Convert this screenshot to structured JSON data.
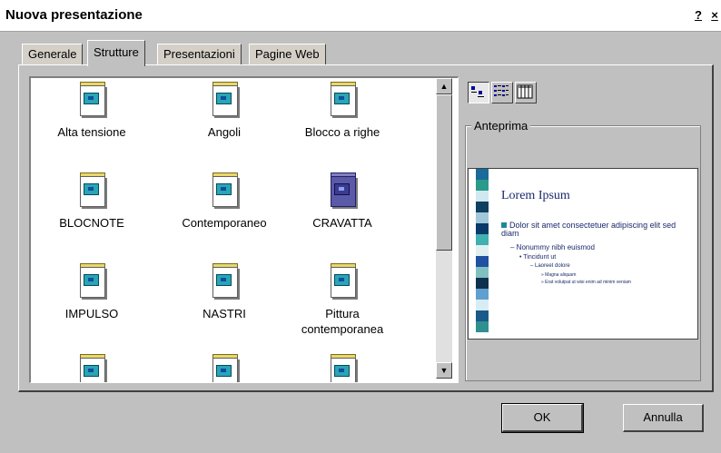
{
  "window": {
    "title": "Nuova presentazione",
    "help_glyph": "?",
    "close_glyph": "×"
  },
  "tabs": [
    {
      "label": "Generale",
      "active": false
    },
    {
      "label": "Strutture",
      "active": true
    },
    {
      "label": "Presentazioni",
      "active": false
    },
    {
      "label": "Pagine Web",
      "active": false
    }
  ],
  "templates": [
    {
      "label": "Alta tensione"
    },
    {
      "label": "Angoli"
    },
    {
      "label": "Blocco a righe"
    },
    {
      "label": "BLOCNOTE"
    },
    {
      "label": "Contemporaneo"
    },
    {
      "label": "CRAVATTA",
      "selected": true
    },
    {
      "label": "IMPULSO"
    },
    {
      "label": "NASTRI"
    },
    {
      "label": "Pittura contemporanea"
    },
    {
      "label": ""
    },
    {
      "label": ""
    },
    {
      "label": ""
    }
  ],
  "view_buttons": [
    {
      "icon": "large-icons-view-icon",
      "pressed": true
    },
    {
      "icon": "list-view-icon",
      "pressed": false
    },
    {
      "icon": "details-view-icon",
      "pressed": false
    }
  ],
  "preview": {
    "group_label": "Anteprima",
    "slide_title": "Lorem Ipsum",
    "bullets": [
      "Dolor sit amet consectetuer adipiscing elit sed diam",
      "– Nonummy nibh euismod",
      "• Tincidunt ut",
      "– Laoreet dolore",
      "» Magna aliquam",
      "» Erat volutpat ut wisi enim ad minim veniam"
    ],
    "stripe_colors": [
      "#1a6a9a",
      "#2a9a8a",
      "#d0e8f0",
      "#104060",
      "#a0c8d8",
      "#0a3a6a",
      "#40b0b0",
      "#e0f0f0",
      "#2050a0",
      "#80c0c0",
      "#103050",
      "#60a0d0",
      "#d8ecf4",
      "#1a5a8a",
      "#309090"
    ]
  },
  "buttons": {
    "ok": "OK",
    "cancel": "Annulla"
  }
}
